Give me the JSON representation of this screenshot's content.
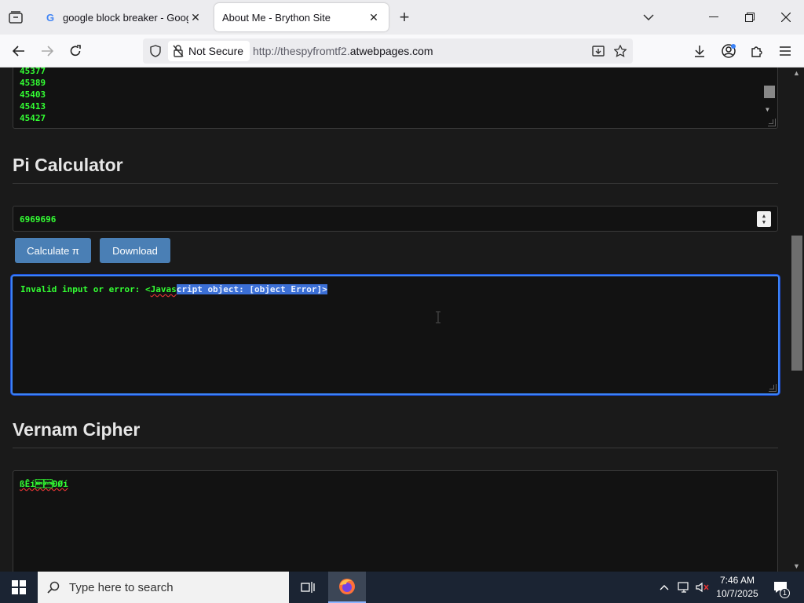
{
  "tabs": [
    {
      "title": "google block breaker - Google",
      "favicon": "G",
      "active": false
    },
    {
      "title": "About Me - Brython Site",
      "active": true
    }
  ],
  "navbar": {
    "security_label": "Not Secure",
    "url_prefix": "http://thespyfromtf2.",
    "url_host": "atwebpages.com"
  },
  "primes": [
    "45377",
    "45389",
    "45403",
    "45413",
    "45427"
  ],
  "pi_section": {
    "title": "Pi Calculator",
    "input_value": "6969696",
    "calc_label": "Calculate π",
    "download_label": "Download",
    "output_prefix": "Invalid input or error: <",
    "output_error_word": "Javas",
    "output_selected": "cript object: [object Error]>"
  },
  "vernam_section": {
    "title": "Vernam Cipher",
    "text": "ßÊí\u0019\u0016ÐØí"
  },
  "taskbar": {
    "search_placeholder": "Type here to search",
    "time": "7:46 AM",
    "date": "10/7/2025",
    "notification_count": "1"
  },
  "colors": {
    "accent_green": "#33ff33",
    "button_blue": "#4a7fb5",
    "focus_blue": "#3b82f6"
  }
}
